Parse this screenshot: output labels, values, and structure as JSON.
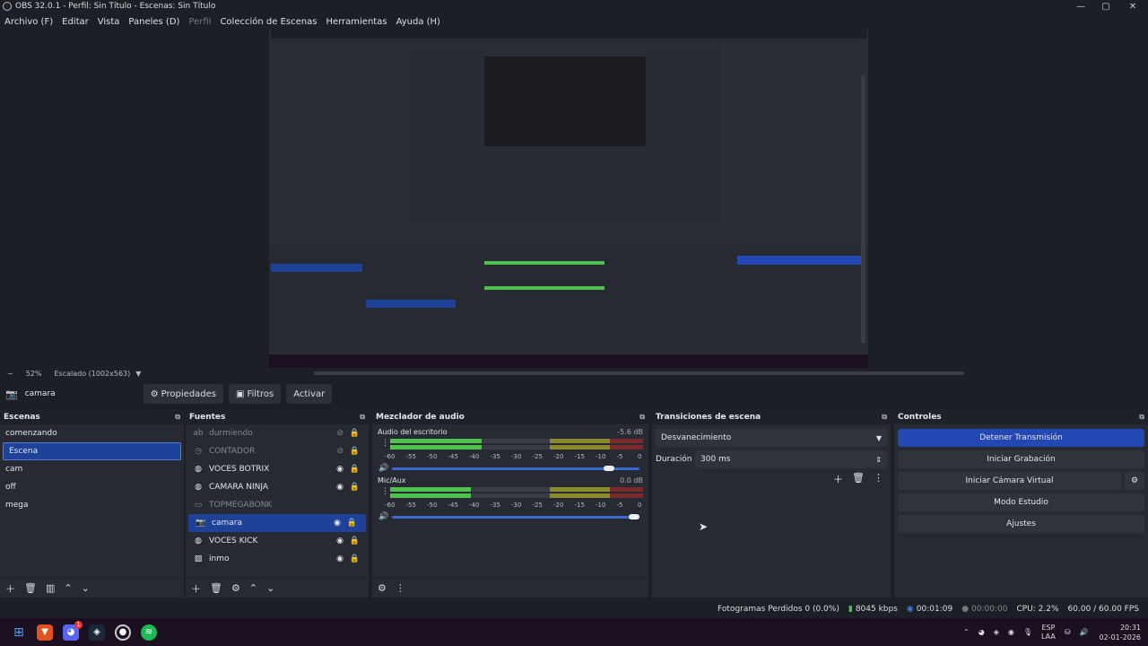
{
  "window": {
    "title": "OBS 32.0.1 - Perfil: Sin Título - Escenas: Sin Título",
    "min": "—",
    "max": "▢",
    "close": "✕"
  },
  "menu": [
    "Archivo (F)",
    "Editar",
    "Vista",
    "Paneles (D)",
    "Perfil",
    "Colección de Escenas",
    "Herramientas",
    "Ayuda (H)"
  ],
  "zoom": {
    "minus": "−",
    "percent": "52%",
    "scale_label": "Escalado (1002x563)",
    "dropdown": "▼"
  },
  "context": {
    "source_icon": "camera-icon",
    "source_name": "camara",
    "properties": "Propiedades",
    "filters": "Filtros",
    "activate": "Activar"
  },
  "scenes": {
    "title": "Escenas",
    "items": [
      "comenzando",
      "Escena",
      "cam",
      "off",
      "mega"
    ],
    "selected_index": 1
  },
  "sources": {
    "title": "Fuentes",
    "items": [
      {
        "name": "durmiendo",
        "icon": "text-icon",
        "visible": false
      },
      {
        "name": "CONTADOR",
        "icon": "clock-icon",
        "visible": false
      },
      {
        "name": "VOCES BOTRIX",
        "icon": "browser-icon",
        "visible": true
      },
      {
        "name": "CAMARA NINJA",
        "icon": "browser-icon",
        "visible": true
      },
      {
        "name": "TOPMEGABONK",
        "icon": "window-icon",
        "visible": false
      },
      {
        "name": "camara",
        "icon": "camera-icon",
        "visible": true
      },
      {
        "name": "VOCES KICK",
        "icon": "browser-icon",
        "visible": true
      },
      {
        "name": "inmo",
        "icon": "image-icon",
        "visible": true
      }
    ],
    "selected_index": 5
  },
  "mixer": {
    "title": "Mezclador de audio",
    "channels": [
      {
        "name": "Audio del escritorio",
        "db": "-5.6 dB",
        "level": 0.36,
        "volume": 0.9
      },
      {
        "name": "Mic/Aux",
        "db": "0.0 dB",
        "level": 0.32,
        "volume": 1.0
      }
    ],
    "scale": [
      "-60",
      "-55",
      "-50",
      "-45",
      "-40",
      "-35",
      "-30",
      "-25",
      "-20",
      "-15",
      "-10",
      "-5",
      "0"
    ]
  },
  "transitions": {
    "title": "Transiciones de escena",
    "selected": "Desvanecimiento",
    "duration_label": "Duración",
    "duration_value": "300 ms"
  },
  "controls": {
    "title": "Controles",
    "stop_stream": "Detener Transmisión",
    "start_record": "Iniciar Grabación",
    "start_vcam": "Iniciar Cámara Virtual",
    "studio_mode": "Modo Estudio",
    "settings": "Ajustes"
  },
  "status": {
    "dropped": "Fotogramas Perdidos 0 (0.0%)",
    "bitrate": "8045 kbps",
    "stream_time": "00:01:09",
    "record_time": "00:00:00",
    "cpu": "CPU: 2.2%",
    "fps": "60.00 / 60.00 FPS"
  },
  "taskbar": {
    "lang_top": "ESP",
    "lang_bottom": "LAA",
    "time": "20:31",
    "date": "02-01-2026",
    "discord_badge": "1"
  }
}
